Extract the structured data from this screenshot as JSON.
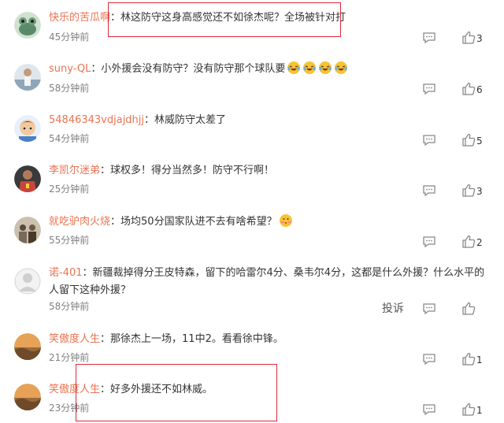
{
  "comments": [
    {
      "user": "快乐的苦瓜啊",
      "colon": "：",
      "text": "林这防守这身高感觉还不如徐杰呢？全场被针对打",
      "time": "45分钟前",
      "likes": "3",
      "avatar_color": "#5a8a6a",
      "avatar_icon": "frog-avatar"
    },
    {
      "user": "suny-QL",
      "colon": "：",
      "text": "小外援会没有防守？没有防守那个球队要",
      "emoji_count": 4,
      "emoji": "laughing-crying-emoji",
      "time": "58分钟前",
      "likes": "6",
      "avatar_color": "#8fa6b8",
      "avatar_icon": "player-avatar"
    },
    {
      "user": "54846343vdjajdhjj",
      "colon": "：",
      "text": "林威防守太差了",
      "time": "54分钟前",
      "likes": "5",
      "avatar_color": "#4a7fc4",
      "avatar_icon": "cartoon-boy-avatar"
    },
    {
      "user": "李凯尔迷弟",
      "colon": "：",
      "text": "球权多！得分当然多！防守不行啊！",
      "time": "25分钟前",
      "likes": "3",
      "avatar_color": "#c8453a",
      "avatar_icon": "red-jersey-avatar"
    },
    {
      "user": "就吃驴肉火烧",
      "colon": "：",
      "text": "场均50分国家队进不去有啥希望？",
      "emoji": "blushing-emoji",
      "time": "55分钟前",
      "likes": "2",
      "avatar_color": "#7a6a5a",
      "avatar_icon": "group-photo-avatar"
    },
    {
      "user": "诺-401",
      "colon": "：",
      "text": "新疆裁掉得分王皮特森，留下的哈雷尔4分、桑韦尔4分，这都是什么外援？什么水平的人留下这种外援？",
      "time": "58分钟前",
      "likes": "",
      "report": "投诉",
      "avatar_color": "#e0e0e0",
      "avatar_icon": "default-avatar"
    },
    {
      "user": "笑傲度人生",
      "colon": "：",
      "text": "那徐杰上一场，11中2。看看徐中锋。",
      "time": "21分钟前",
      "likes": "1",
      "avatar_color": "#9a6a3a",
      "avatar_icon": "landscape-avatar"
    },
    {
      "user": "笑傲度人生",
      "colon": "：",
      "text": "好多外援还不如林威。",
      "time": "23分钟前",
      "likes": "1",
      "avatar_color": "#9a6a3a",
      "avatar_icon": "landscape-avatar"
    }
  ],
  "colors": {
    "username": "#eb7350",
    "highlight": "#e0283a",
    "muted": "#808080"
  }
}
